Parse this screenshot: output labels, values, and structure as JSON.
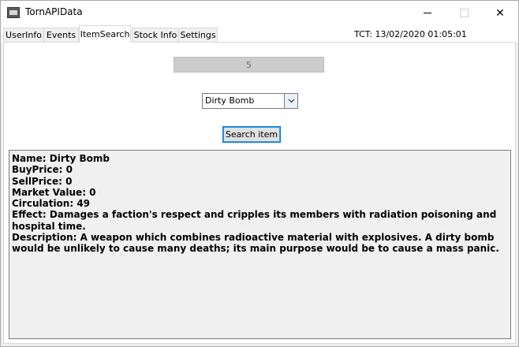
{
  "window": {
    "title": "TornAPIData",
    "icon": "app-icon"
  },
  "titlebar_buttons": {
    "minimize": "minimize-icon",
    "maximize": "maximize-icon",
    "close": "close-icon",
    "close_glyph": "✕"
  },
  "tabs": [
    {
      "label": "UserInfo"
    },
    {
      "label": "Events"
    },
    {
      "label": "ItemSearch",
      "active": true
    },
    {
      "label": "Stock Info"
    },
    {
      "label": "Settings"
    }
  ],
  "tct": "TCT: 13/02/2020 01:05:01",
  "search": {
    "level_value": "5",
    "item_selected": "Dirty Bomb",
    "button_label": "Search item"
  },
  "result": {
    "name": "Name: Dirty Bomb",
    "buy_price": "BuyPrice: 0",
    "sell_price": "SellPrice: 0",
    "market_value": "Market Value: 0",
    "circulation": "Circulation: 49",
    "effect": "Effect: Damages a faction's respect and cripples its members with radiation poisoning and hospital time.",
    "description": "Description: A weapon which combines radioactive material with explosives. A dirty bomb would be unlikely to cause many deaths; its main purpose would be to cause a mass panic."
  }
}
